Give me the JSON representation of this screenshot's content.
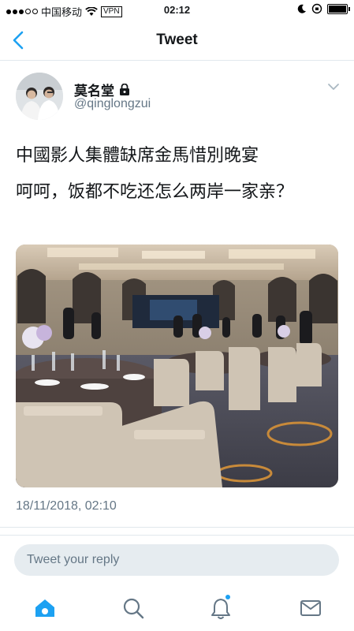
{
  "status_bar": {
    "carrier": "中国移动",
    "vpn": "VPN",
    "time": "02:12"
  },
  "nav": {
    "title": "Tweet",
    "back_icon": "chevron-left-icon"
  },
  "tweet": {
    "author_name": "莫名堂",
    "author_handle": "@qinglongzui",
    "text_lines": [
      "中國影人集體缺席金馬惜別晚宴",
      "呵呵，饭都不吃还怎么两岸一家亲？"
    ],
    "timestamp": "18/11/2018, 02:10"
  },
  "reply": {
    "placeholder": "Tweet your reply"
  },
  "tab_bar": {
    "items": [
      "home-icon",
      "search-icon",
      "notifications-icon",
      "messages-icon"
    ],
    "active": "home-icon"
  },
  "colors": {
    "accent": "#1da1f2",
    "muted": "#657786",
    "divider": "#e1e8ed"
  }
}
